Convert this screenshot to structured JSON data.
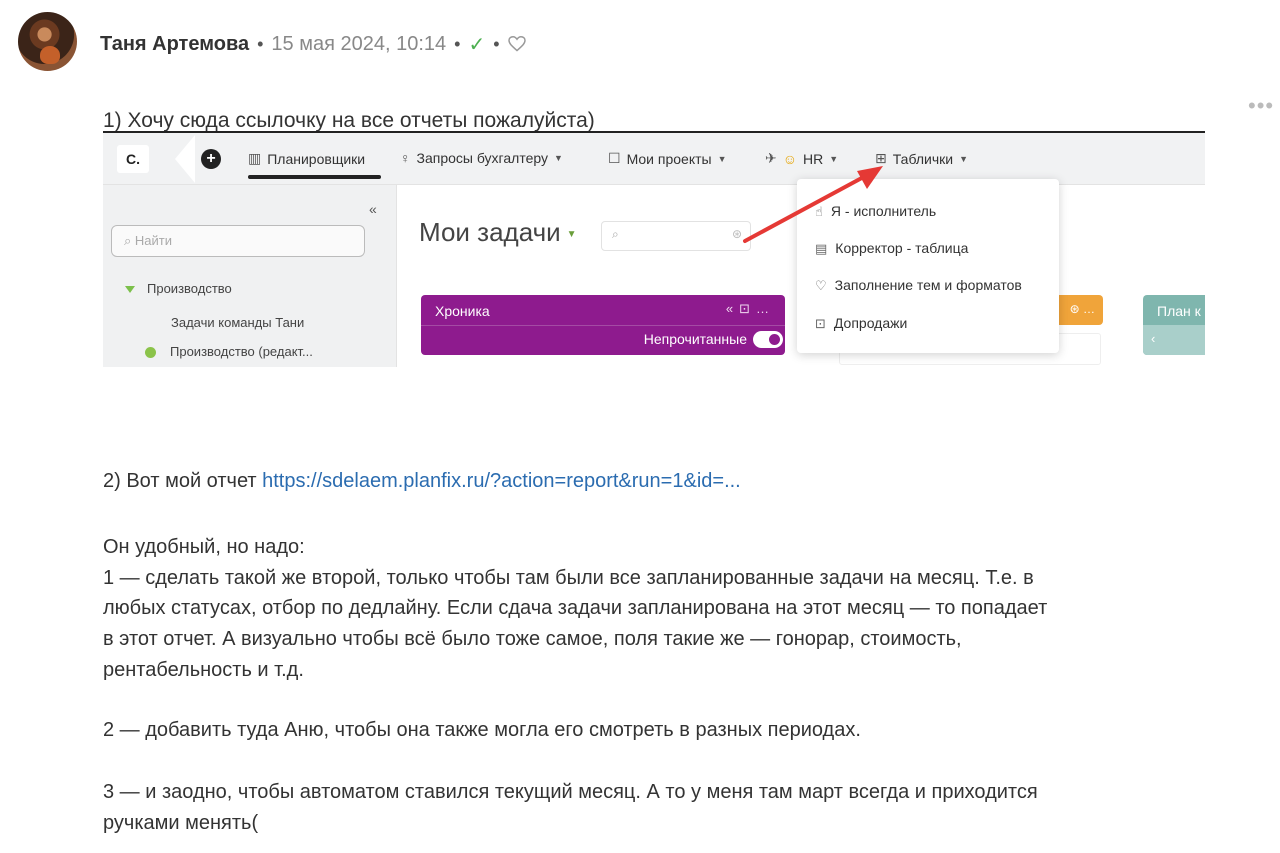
{
  "post": {
    "author": "Таня Артемова",
    "datetime": "15 мая 2024, 10:14",
    "check_icon": "check-icon",
    "like_icon": "heart-icon",
    "more_icon": "more-dots-icon"
  },
  "message": {
    "line1": "1) Хочу сюда ссылочку на все отчеты пожалуйста)",
    "line2_text": "2) Вот мой отчет ",
    "line2_link": "https://sdelaem.planfix.ru/?action=report&run=1&id=...",
    "para1": "Он удобный, но надо:",
    "para2": [
      "1 — сделать такой же второй, только чтобы там были все запланированные задачи на месяц. Т.е. в",
      "любых статусах, отбор по дедлайну. Если сдача задачи запланирована на этот месяц — то попадает",
      "в этот отчет. А визуально чтобы всё было тоже самое, поля такие же — гонорар, стоимость,",
      "рентабельность и т.д."
    ],
    "para3": "2 — добавить туда Аню, чтобы она также могла его смотреть в разных периодах.",
    "para4": [
      "3 — и заодно, чтобы автоматом ставился текущий месяц. А то у меня там март всегда и приходится",
      "ручками менять("
    ]
  },
  "screenshot": {
    "logo": "С.",
    "nav": [
      {
        "label": "Планировщики",
        "icon": "calendar-icon"
      },
      {
        "label": "Запросы бухгалтеру",
        "icon": "lightbulb-icon"
      },
      {
        "label": "Мои проекты",
        "icon": "briefcase-icon"
      },
      {
        "label": "HR",
        "icon": "smile-icon"
      },
      {
        "label": "Таблички",
        "icon": "table-icon"
      }
    ],
    "sidebar": {
      "collapse": "«",
      "search_placeholder": "Найти",
      "items": [
        "Производство",
        "Задачи команды Тани",
        "Производство (редакт..."
      ]
    },
    "main": {
      "title": "Мои задачи",
      "card_title": "Хроника",
      "card_unread": "Непрочитанные",
      "teal_title": "План к",
      "teal_sub": "‹"
    },
    "dropdown": [
      "Я - исполнитель",
      "Корректор - таблица",
      "Заполнение тем и форматов",
      "Допродажи"
    ],
    "arrow_color": "#e53935",
    "brand_purple": "#8e1b8e"
  }
}
